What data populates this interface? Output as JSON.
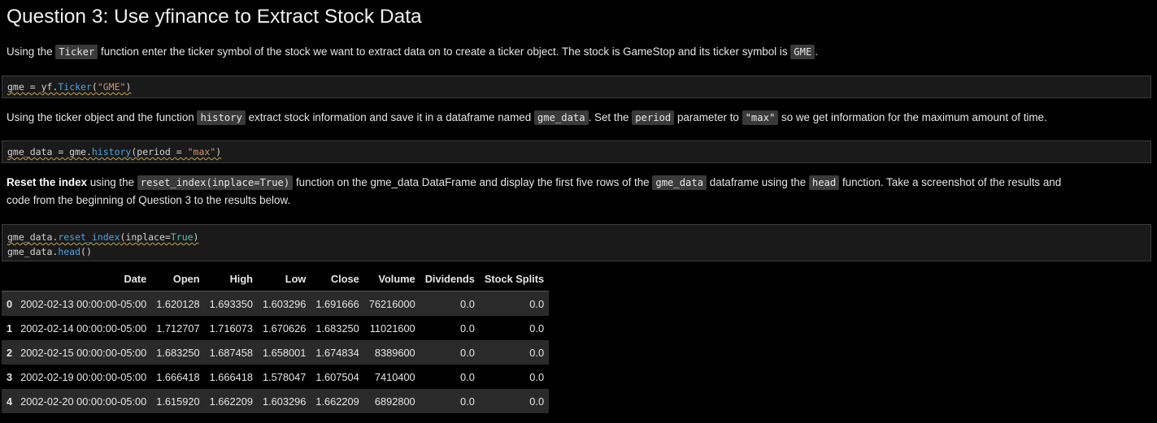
{
  "heading": "Question 3: Use yfinance to Extract Stock Data",
  "para1": {
    "t1": "Using the ",
    "c1": "Ticker",
    "t2": " function enter the ticker symbol of the stock we want to extract data on to create a ticker object. The stock is GameStop and its ticker symbol is ",
    "c2": "GME",
    "t3": "."
  },
  "cell1": {
    "var": "gme",
    "eq": " = ",
    "obj": "yf.",
    "fn": "Ticker",
    "open": "(",
    "arg": "\"GME\"",
    "close": ")"
  },
  "para2": {
    "t1": "Using the ticker object and the function ",
    "c1": "history",
    "t2": " extract stock information and save it in a dataframe named ",
    "c2": "gme_data",
    "t3": ". Set the ",
    "c3": "period",
    "t4": " parameter to ",
    "c4": "\"max\"",
    "t5": " so we get information for the maximum amount of time."
  },
  "cell2": {
    "var": "gme_data",
    "eq": " = ",
    "obj": "gme.",
    "fn": "history",
    "open": "(",
    "param": "period",
    "peq": " = ",
    "arg": "\"max\"",
    "close": ")"
  },
  "para3": {
    "bold": "Reset the index",
    "t1": " using the ",
    "c1": "reset_index(inplace=True)",
    "t2": " function on the gme_data DataFrame and display the first five rows of the ",
    "c2": "gme_data",
    "t3": " dataframe using the ",
    "c3": "head",
    "t4": " function. Take a screenshot of the results and",
    "line2": "code from the beginning of Question 3 to the results below."
  },
  "cell3": {
    "l1_var": "gme_data",
    "l1_dot": ".",
    "l1_fn": "reset_index",
    "l1_open": "(",
    "l1_param": "inplace",
    "l1_eq": "=",
    "l1_val": "True",
    "l1_close": ")",
    "l2_var": "gme_data",
    "l2_dot": ".",
    "l2_fn": "head",
    "l2_call": "()"
  },
  "table": {
    "headers": [
      "",
      "Date",
      "Open",
      "High",
      "Low",
      "Close",
      "Volume",
      "Dividends",
      "Stock Splits"
    ],
    "rows": [
      [
        "0",
        "2002-02-13 00:00:00-05:00",
        "1.620128",
        "1.693350",
        "1.603296",
        "1.691666",
        "76216000",
        "0.0",
        "0.0"
      ],
      [
        "1",
        "2002-02-14 00:00:00-05:00",
        "1.712707",
        "1.716073",
        "1.670626",
        "1.683250",
        "11021600",
        "0.0",
        "0.0"
      ],
      [
        "2",
        "2002-02-15 00:00:00-05:00",
        "1.683250",
        "1.687458",
        "1.658001",
        "1.674834",
        "8389600",
        "0.0",
        "0.0"
      ],
      [
        "3",
        "2002-02-19 00:00:00-05:00",
        "1.666418",
        "1.666418",
        "1.578047",
        "1.607504",
        "7410400",
        "0.0",
        "0.0"
      ],
      [
        "4",
        "2002-02-20 00:00:00-05:00",
        "1.615920",
        "1.662209",
        "1.603296",
        "1.662209",
        "6892800",
        "0.0",
        "0.0"
      ]
    ]
  }
}
